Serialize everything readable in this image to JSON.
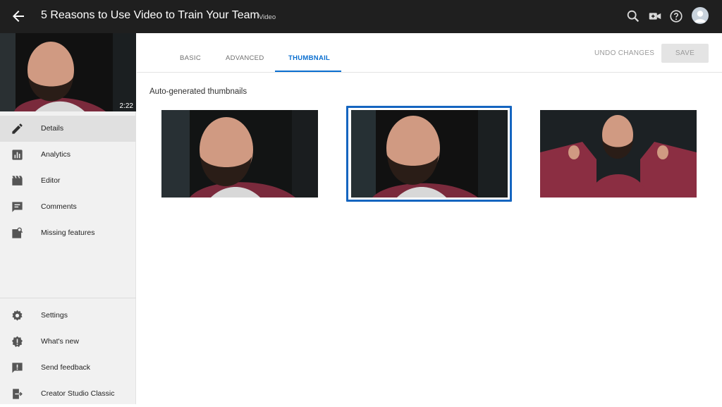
{
  "header": {
    "back_icon": "arrow-back-icon",
    "title": "5 Reasons to Use Video to Train Your Team",
    "subtitle": "Video",
    "icons": [
      "search-icon",
      "video-camera-icon",
      "help-icon",
      "account-avatar-icon"
    ]
  },
  "video": {
    "duration": "2:22"
  },
  "sidebar": {
    "items": [
      {
        "label": "Details",
        "icon": "pencil-icon",
        "active": true
      },
      {
        "label": "Analytics",
        "icon": "bar-chart-icon"
      },
      {
        "label": "Editor",
        "icon": "film-icon"
      },
      {
        "label": "Comments",
        "icon": "comment-icon"
      },
      {
        "label": "Missing features",
        "icon": "missing-features-icon"
      }
    ],
    "bottom_items": [
      {
        "label": "Settings",
        "icon": "gear-icon"
      },
      {
        "label": "What's new",
        "icon": "new-badge-icon"
      },
      {
        "label": "Send feedback",
        "icon": "feedback-icon"
      },
      {
        "label": "Creator Studio Classic",
        "icon": "exit-icon"
      }
    ]
  },
  "tabs": [
    {
      "label": "BASIC"
    },
    {
      "label": "ADVANCED"
    },
    {
      "label": "THUMBNAIL",
      "active": true
    }
  ],
  "actions": {
    "undo_label": "UNDO CHANGES",
    "save_label": "SAVE"
  },
  "thumbnails": {
    "heading": "Auto-generated thumbnails",
    "selected_index": 1
  },
  "colors": {
    "topbar": "#1f1f1f",
    "accent": "#0b6fd0",
    "sidebar": "#f1f1f1"
  }
}
